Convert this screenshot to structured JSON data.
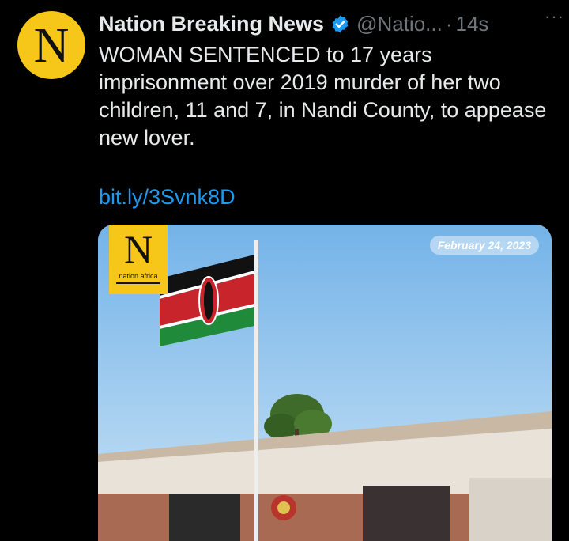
{
  "account": {
    "avatar_letter": "N",
    "name": "Nation Breaking News",
    "handle": "@Natio...",
    "separator": "·",
    "time": "14s",
    "more": "···"
  },
  "tweet": {
    "text": "WOMAN SENTENCED to 17 years imprisonment over 2019 murder of her two children, 11 and 7, in Nandi County, to appease new lover.",
    "link": "bit.ly/3Svnk8D"
  },
  "media": {
    "logo_letter": "N",
    "logo_site": "nation.africa",
    "date": "February 24, 2023"
  },
  "colors": {
    "background": "#000000",
    "text": "#e7e9ea",
    "muted": "#71767b",
    "link": "#1d9bf0",
    "brand": "#f6c619"
  }
}
